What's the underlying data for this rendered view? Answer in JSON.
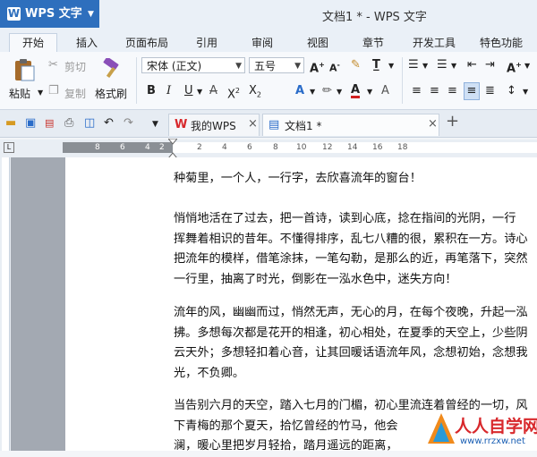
{
  "app": {
    "name": "WPS 文字",
    "logo": "W"
  },
  "window": {
    "title": "文档1 * - WPS 文字"
  },
  "ribbon_tabs": [
    "开始",
    "插入",
    "页面布局",
    "引用",
    "审阅",
    "视图",
    "章节",
    "开发工具",
    "特色功能"
  ],
  "active_tab": "开始",
  "clipboard": {
    "paste": "粘贴",
    "cut": "剪切",
    "copy": "复制",
    "format_painter": "格式刷"
  },
  "font": {
    "family": "宋体 (正文)",
    "size": "五号"
  },
  "doc_tabs": [
    {
      "label": "我的WPS"
    },
    {
      "label": "文档1 *"
    }
  ],
  "ruler_left": [
    "8",
    "6",
    "4",
    "2"
  ],
  "ruler_right": [
    "2",
    "4",
    "6",
    "8",
    "10",
    "12",
    "14",
    "16",
    "18"
  ],
  "document": {
    "paragraphs": [
      [
        "种菊里，一个人，一行字，去欣喜流年的窗台！"
      ],
      [
        "悄悄地活在了过去，把一首诗，读到心底，捻在指间的光阴，一行",
        "挥舞着相识的昔年。不懂得排序，乱七八糟的很，累积在一方。诗心",
        "把流年的模样，借笔涂抹，一笔勾勒，是那么的近，再笔落下，突然",
        "一行里，抽离了时光，倒影在一泓水色中，迷失方向！"
      ],
      [
        "流年的风，幽幽而过，悄然无声，无心的月，在每个夜晚，升起一泓",
        "拂。多想每次都是花开的相逢，初心相处，在夏季的天空上，少些阴",
        "云天外；多想轻扣着心音，让其回暖话语流年风，念想初始，念想我",
        "光，不负卿。"
      ],
      [
        "当告别六月的天空，踏入七月的门楣，初心里流连着曾经的一切，风",
        "下青梅的那个夏天，拾忆曾经的竹马，他会",
        "澜，暖心里把岁月轻拾，踏月遥远的距离，"
      ]
    ]
  },
  "watermark": {
    "text": "人人自学网",
    "url": "www.rrzxw.net"
  }
}
